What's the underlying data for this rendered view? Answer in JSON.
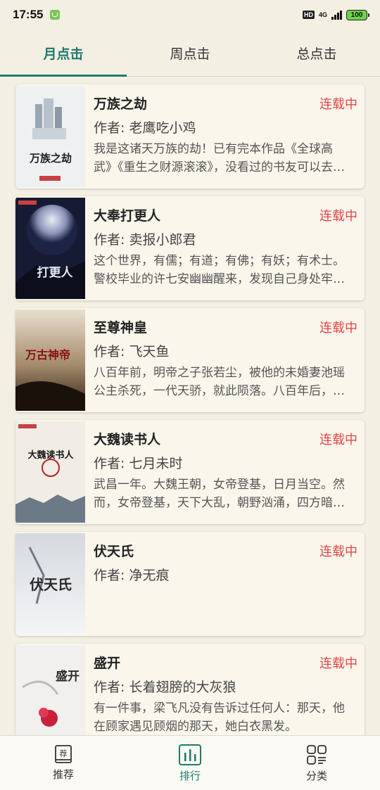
{
  "status_bar": {
    "time": "17:55",
    "hd": "HD",
    "network": "4G",
    "battery": "100"
  },
  "tabs": [
    {
      "label": "月点击",
      "active": true
    },
    {
      "label": "周点击",
      "active": false
    },
    {
      "label": "总点击",
      "active": false
    }
  ],
  "books": [
    {
      "title": "万族之劫",
      "status": "连载中",
      "author": "作者: 老鹰吃小鸡",
      "desc": "我是这诸天万族的劫！已有完本作品《全球高武》《重生之财源滚滚》，没看过的书友可以去看看哦。",
      "cover_text": "万族之劫"
    },
    {
      "title": "大奉打更人",
      "status": "连载中",
      "author": "作者: 卖报小郎君",
      "desc": "这个世界，有儒；有道；有佛；有妖；有术士。警校毕业的许七安幽幽醒来，发现自己身处牢狱之中。",
      "cover_text": "打更人"
    },
    {
      "title": "至尊神皇",
      "status": "连载中",
      "author": "作者: 飞天鱼",
      "desc": "八百年前，明帝之子张若尘，被他的未婚妻池瑶公主杀死，一代天骄，就此陨落。八百年后，张若尘重新活了过来。",
      "cover_text": "万古神帝"
    },
    {
      "title": "大魏读书人",
      "status": "连载中",
      "author": "作者: 七月未时",
      "desc": "武昌一年。大魏王朝，女帝登基，日月当空。然而，女帝登基，天下大乱，朝野汹涌，四方暗流涌动。",
      "cover_text": "大魏读书人"
    },
    {
      "title": "伏天氏",
      "status": "连载中",
      "author": "作者: 净无痕",
      "desc": "",
      "cover_text": "伏天氏"
    },
    {
      "title": "盛开",
      "status": "连载中",
      "author": "作者: 长着翅膀的大灰狼",
      "desc": "有一件事，梁飞凡没有告诉过任何人：那天，他在顾家遇见顾烟的那天，她白衣黑发。",
      "cover_text": "盛开"
    }
  ],
  "bottom_nav": [
    {
      "label": "推荐",
      "icon": "recommend-icon",
      "icon_text": "荐",
      "active": false
    },
    {
      "label": "排行",
      "icon": "ranking-icon",
      "active": true
    },
    {
      "label": "分类",
      "icon": "category-icon",
      "active": false
    }
  ],
  "colors": {
    "accent": "#1e7a6c",
    "status_red": "#e04848",
    "background": "#f4efe3"
  }
}
